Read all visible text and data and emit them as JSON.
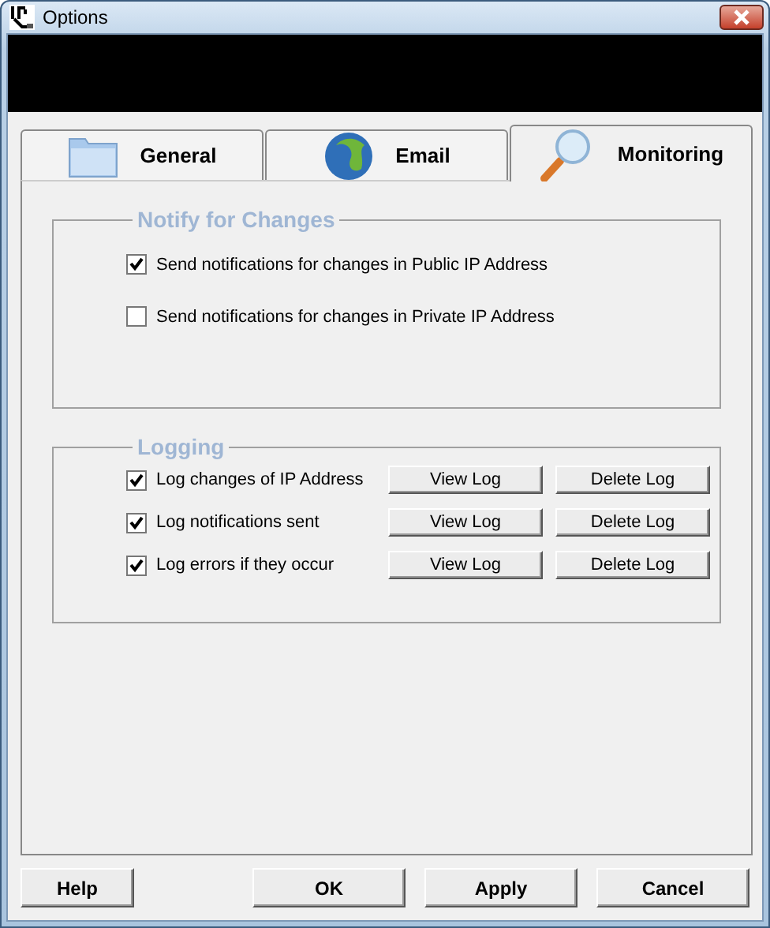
{
  "window": {
    "title": "Options"
  },
  "tabs": [
    {
      "label": "General",
      "kind": "folder",
      "selected": false
    },
    {
      "label": "Email",
      "kind": "globe",
      "selected": false
    },
    {
      "label": "Monitoring",
      "kind": "magnifier",
      "selected": true
    }
  ],
  "notify": {
    "title": "Notify for Changes",
    "options": [
      {
        "label": "Send notifications for changes in Public IP Address",
        "checked": true
      },
      {
        "label": "Send notifications for changes in Private IP Address",
        "checked": false
      }
    ]
  },
  "logging": {
    "title": "Logging",
    "rows": [
      {
        "label": "Log changes of IP Address",
        "checked": true,
        "buttons": [
          "View Log",
          "Delete Log"
        ]
      },
      {
        "label": "Log notifications sent",
        "checked": true,
        "buttons": [
          "View Log",
          "Delete Log"
        ]
      },
      {
        "label": "Log errors if they occur",
        "checked": true,
        "buttons": [
          "View Log",
          "Delete Log"
        ]
      }
    ]
  },
  "footer": {
    "left": [
      "Help"
    ],
    "right": [
      "OK",
      "Apply",
      "Cancel"
    ]
  }
}
